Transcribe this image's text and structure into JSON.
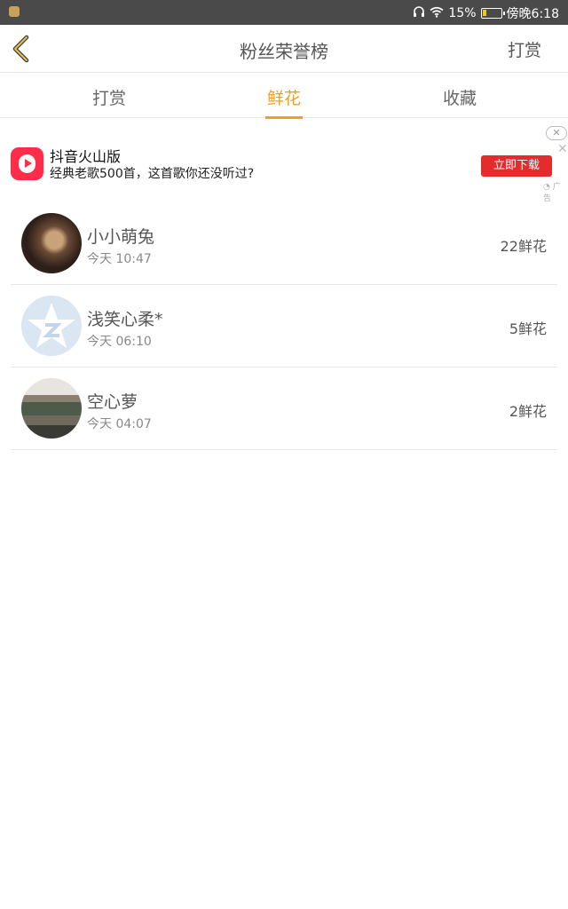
{
  "status_bar": {
    "battery": "15%",
    "time": "傍晚6:18"
  },
  "nav": {
    "title": "粉丝荣誉榜",
    "right_button": "打赏"
  },
  "tabs": [
    {
      "label": "打赏",
      "active": false
    },
    {
      "label": "鲜花",
      "active": true
    },
    {
      "label": "收藏",
      "active": false
    }
  ],
  "ad": {
    "app_name": "抖音火山版",
    "description": "经典老歌500首，这首歌你还没听过?",
    "download_label": "立即下载",
    "tag": "广告"
  },
  "list": [
    {
      "name": "小小萌兔",
      "time": "今天 10:47",
      "count": "22鲜花"
    },
    {
      "name": "浅笑心柔*",
      "time": "今天 06:10",
      "count": "5鲜花"
    },
    {
      "name": "空心萝",
      "time": "今天 04:07",
      "count": "2鲜花"
    }
  ],
  "colors": {
    "accent": "#f0a11b",
    "ad_button": "#e52b2b"
  }
}
